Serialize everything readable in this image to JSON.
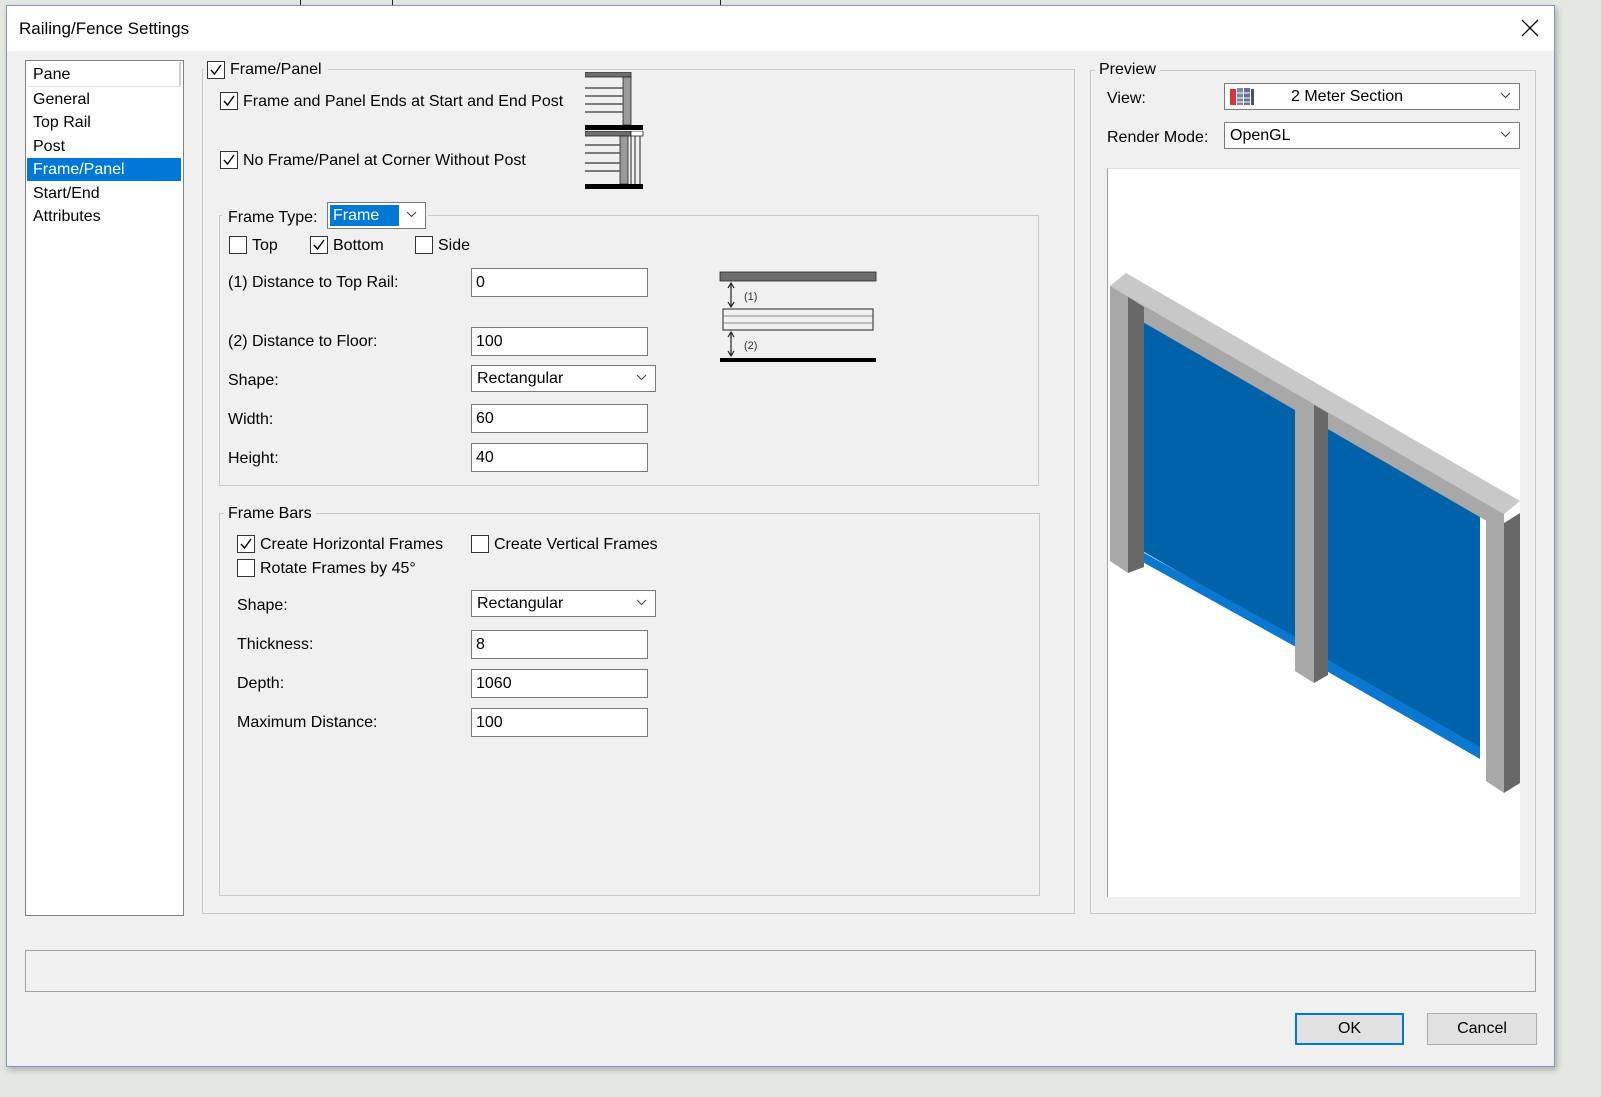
{
  "window": {
    "title": "Railing/Fence Settings"
  },
  "pane_list": {
    "header": "Pane",
    "items": [
      {
        "label": "General",
        "selected": false
      },
      {
        "label": "Top Rail",
        "selected": false
      },
      {
        "label": "Post",
        "selected": false
      },
      {
        "label": "Frame/Panel",
        "selected": true
      },
      {
        "label": "Start/End",
        "selected": false
      },
      {
        "label": "Attributes",
        "selected": false
      }
    ]
  },
  "frame_panel": {
    "group_label": "Frame/Panel",
    "enabled": true,
    "ends_at_posts": {
      "label": "Frame and Panel Ends at Start and End Post",
      "checked": true
    },
    "no_corner_without_post": {
      "label": "No Frame/Panel at Corner Without Post",
      "checked": true
    },
    "frame_type": {
      "label": "Frame Type:",
      "value": "Frame",
      "top": {
        "label": "Top",
        "checked": false
      },
      "bottom": {
        "label": "Bottom",
        "checked": true
      },
      "side": {
        "label": "Side",
        "checked": false
      },
      "distance_top_rail": {
        "label": "(1) Distance to Top Rail:",
        "value": "0"
      },
      "distance_floor": {
        "label": "(2) Distance to Floor:",
        "value": "100"
      },
      "shape": {
        "label": "Shape:",
        "value": "Rectangular"
      },
      "width": {
        "label": "Width:",
        "value": "60"
      },
      "height": {
        "label": "Height:",
        "value": "40"
      },
      "diagram_labels": {
        "one": "(1)",
        "two": "(2)"
      }
    },
    "frame_bars": {
      "group_label": "Frame Bars",
      "horizontal": {
        "label": "Create Horizontal Frames",
        "checked": true
      },
      "vertical": {
        "label": "Create Vertical Frames",
        "checked": false
      },
      "rotate45": {
        "label": "Rotate Frames by 45°",
        "checked": false
      },
      "shape": {
        "label": "Shape:",
        "value": "Rectangular"
      },
      "thickness": {
        "label": "Thickness:",
        "value": "8"
      },
      "depth": {
        "label": "Depth:",
        "value": "1060"
      },
      "max_distance": {
        "label": "Maximum Distance:",
        "value": "100"
      }
    }
  },
  "preview": {
    "group_label": "Preview",
    "view": {
      "label": "View:",
      "value": "2 Meter Section",
      "icon": "railing-section-icon"
    },
    "render_mode": {
      "label": "Render Mode:",
      "value": "OpenGL"
    },
    "colors": {
      "panel": "#0062a8",
      "frame_bar": "#0a78d0",
      "post_light": "#c8c8c8",
      "post_mid": "#a8a8a8",
      "post_dark": "#686868"
    }
  },
  "buttons": {
    "ok": "OK",
    "cancel": "Cancel"
  },
  "status_text": ""
}
